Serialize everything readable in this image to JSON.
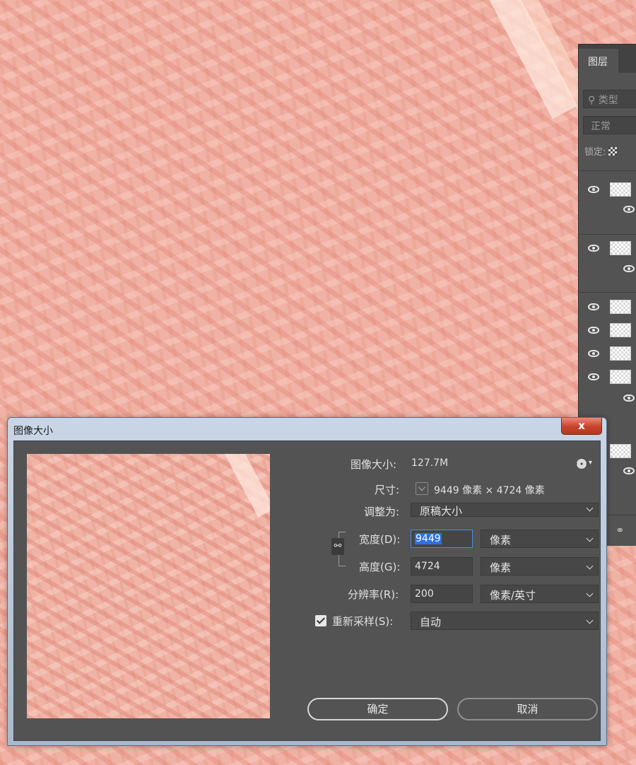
{
  "layers_panel": {
    "tab_label": "图层",
    "search_placeholder": "类型",
    "blend_mode": "正常",
    "lock_label": "锁定:"
  },
  "dialog": {
    "title": "图像大小",
    "close_symbol": "x",
    "image_size_label": "图像大小:",
    "image_size_value": "127.7M",
    "dimensions_label": "尺寸:",
    "dimensions_value": "9449 像素  ×  4724 像素",
    "fit_to_label": "调整为:",
    "fit_to_value": "原稿大小",
    "width_label": "宽度(D):",
    "width_value": "9449",
    "width_unit": "像素",
    "height_label": "高度(G):",
    "height_value": "4724",
    "height_unit": "像素",
    "resolution_label": "分辨率(R):",
    "resolution_value": "200",
    "resolution_unit": "像素/英寸",
    "resample_label": "重新采样(S):",
    "resample_checked": true,
    "resample_value": "自动",
    "ok_label": "确定",
    "cancel_label": "取消"
  }
}
